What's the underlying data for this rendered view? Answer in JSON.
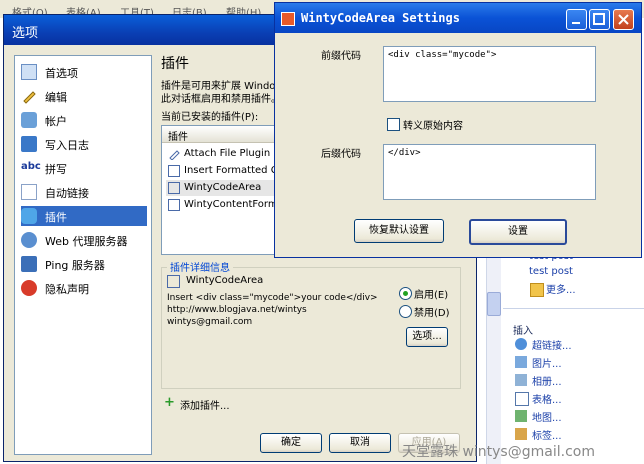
{
  "background_menu": [
    "格式(O)",
    "表格(A)",
    "工具(T)",
    "日志(B)",
    "帮助(H)"
  ],
  "options_dialog": {
    "title": "选项",
    "sidebar": [
      {
        "label": "首选项",
        "icon": "preferences-icon"
      },
      {
        "label": "编辑",
        "icon": "pencil-icon"
      },
      {
        "label": "帐户",
        "icon": "account-icon"
      },
      {
        "label": "写入日志",
        "icon": "weblog-icon"
      },
      {
        "label": "拼写",
        "icon": "spelling-icon"
      },
      {
        "label": "自动链接",
        "icon": "autolink-icon"
      },
      {
        "label": "插件",
        "icon": "plugin-icon",
        "selected": true
      },
      {
        "label": "Web 代理服务器",
        "icon": "proxy-icon"
      },
      {
        "label": "Ping 服务器",
        "icon": "ping-icon"
      },
      {
        "label": "隐私声明",
        "icon": "privacy-icon"
      }
    ],
    "section_title": "插件",
    "description_line1": "插件是可用来扩展 Window",
    "description_line2": "此对话框启用和禁用插件。",
    "installed_label": "当前已安装的插件(P):",
    "plugin_column": "插件",
    "plugins": [
      {
        "name": "Attach File Plugin",
        "icon": "pencil-icon"
      },
      {
        "name": "Insert Formatted Clipb",
        "icon": "checkbox-icon"
      },
      {
        "name": "WintyCodeArea",
        "icon": "checkbox-icon",
        "selected": true
      },
      {
        "name": "WintyContentFormatte",
        "icon": "checkbox-icon"
      }
    ],
    "details": {
      "legend": "插件详细信息",
      "name": "WintyCodeArea",
      "line1": "Insert <div class=\"mycode\">your code</div>",
      "line2": "http://www.blogjava.net/wintys",
      "line3": "wintys@gmail.com",
      "enable_label": "启用(E)",
      "disable_label": "禁用(D)",
      "enabled": true,
      "options_button": "选项..."
    },
    "add_plugin": "添加插件...",
    "ok_button": "确定",
    "cancel_button": "取消",
    "apply_button": "应用(A)"
  },
  "doc_panel": {
    "post1": "test post",
    "post2": "test post",
    "more": "更多...",
    "insert_heading": "插入",
    "insert_items": [
      "超链接...",
      "图片...",
      "相册...",
      "表格...",
      "地图...",
      "标签..."
    ]
  },
  "settings_dialog": {
    "title": "WintyCodeArea Settings",
    "prefix_label": "前缀代码",
    "prefix_value": "<div class=\"mycode\">",
    "escape_label": "转义原始内容",
    "suffix_label": "后缀代码",
    "suffix_value": "</div>",
    "restore_button": "恢复默认设置",
    "set_button": "设置"
  },
  "watermark": "天堂露珠 wintys@gmail.com"
}
